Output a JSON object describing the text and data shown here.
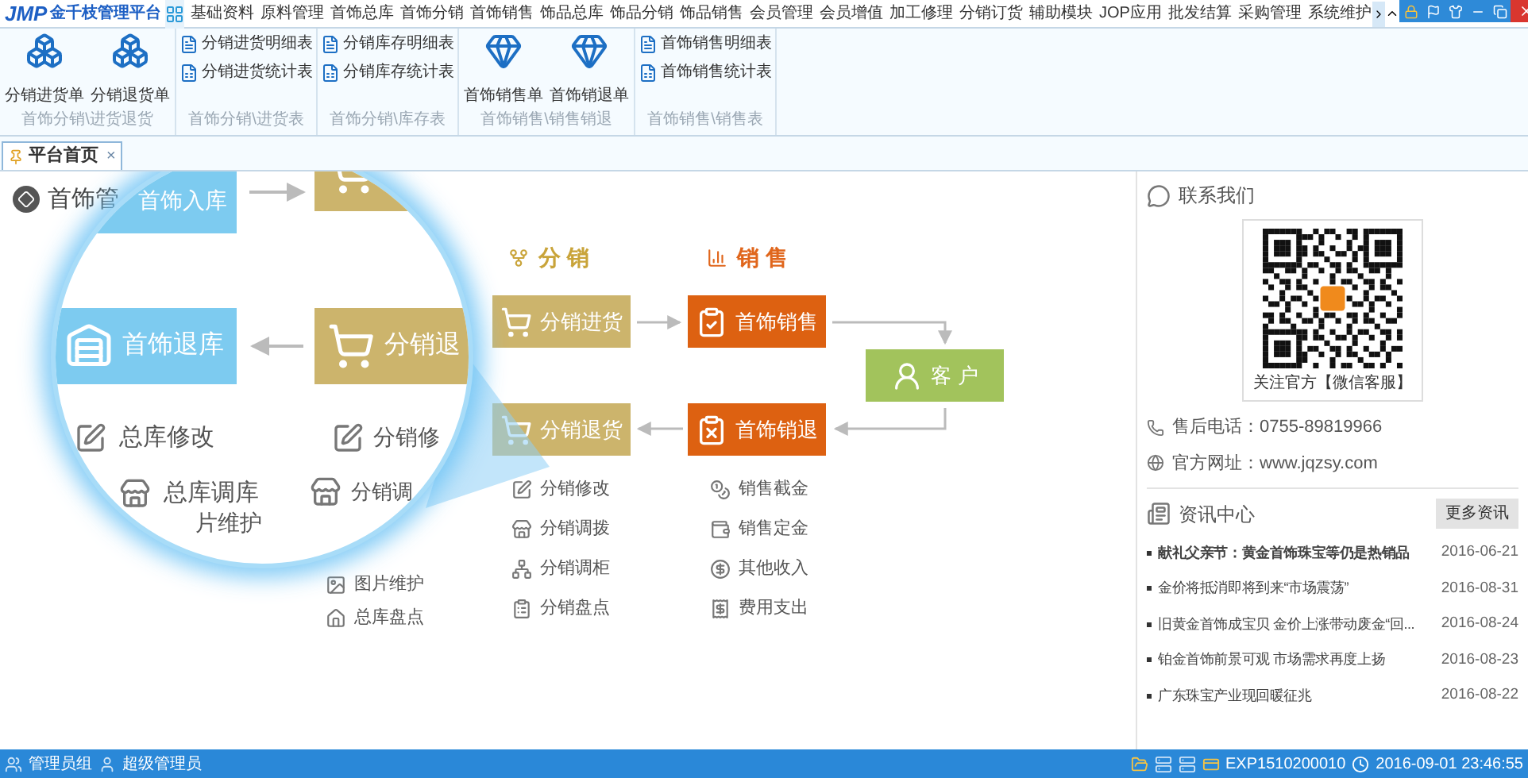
{
  "app": {
    "logo": "JMP",
    "title": "金千枝管理平台"
  },
  "menu": [
    "基础资料",
    "原料管理",
    "首饰总库",
    "首饰分销",
    "首饰销售",
    "饰品总库",
    "饰品分销",
    "饰品销售",
    "会员管理",
    "会员增值",
    "加工修理",
    "分销订货",
    "辅助模块",
    "JOP应用",
    "批发结算",
    "采购管理",
    "系统维护"
  ],
  "ribbon_groups": [
    {
      "kind": "large",
      "caption": "首饰分销\\进货退货",
      "buttons": [
        "分销进货单",
        "分销退货单"
      ]
    },
    {
      "kind": "small",
      "caption": "首饰分销\\进货表",
      "buttons": [
        "分销进货明细表",
        "分销进货统计表"
      ]
    },
    {
      "kind": "small",
      "caption": "首饰分销\\库存表",
      "buttons": [
        "分销库存明细表",
        "分销库存统计表"
      ]
    },
    {
      "kind": "large",
      "caption": "首饰销售\\销售销退",
      "buttons": [
        "首饰销售单",
        "首饰销退单"
      ]
    },
    {
      "kind": "small",
      "caption": "首饰销售\\销售表",
      "buttons": [
        "首饰销售明细表",
        "首饰销售统计表"
      ]
    }
  ],
  "tabs": [
    {
      "label": "平台首页",
      "close": "×",
      "selected": true
    }
  ],
  "page": {
    "title": "首饰管",
    "headers": [
      {
        "label": "分 销",
        "color": "#c9a43a"
      },
      {
        "label": "销 售",
        "color": "#e0661c"
      }
    ],
    "nodes": [
      {
        "label": "分销进货",
        "color": "#ccb46c"
      },
      {
        "label": "首饰销售",
        "color": "#dd6111"
      },
      {
        "label": "客 户",
        "color": "#a2c35c"
      },
      {
        "label": "首饰销退",
        "color": "#dd6111"
      },
      {
        "label": "分销退货",
        "color": "#ccb46c"
      }
    ],
    "left_list": [
      "图片维护",
      "总库盘点"
    ],
    "distribution_list": [
      "分销修改",
      "分销调拨",
      "分销调柜",
      "分销盘点"
    ],
    "sales_list": [
      "销售截金",
      "销售定金",
      "其他收入",
      "费用支出"
    ],
    "magnifier": {
      "nodes": [
        {
          "label": "首饰入库",
          "color": "#7dcbf0"
        },
        {
          "color": "#ccb46c"
        },
        {
          "label": "首饰退库",
          "color": "#7dcbf0"
        },
        {
          "label": "分销退",
          "color": "#ccb46c"
        }
      ],
      "left_items": [
        "总库修改",
        "总库调库",
        "片维护"
      ],
      "right_items": [
        "分销修",
        "分销调"
      ]
    }
  },
  "contact": {
    "title": "联系我们",
    "qr_caption": "关注官方【微信客服】",
    "phone": "售后电话：0755-89819966",
    "website": "官方网址：www.jqzsy.com"
  },
  "news": {
    "title": "资讯中心",
    "more": "更多资讯",
    "items": [
      {
        "title": "献礼父亲节：黄金首饰珠宝等仍是热销品",
        "date": "2016-06-21",
        "bold": true
      },
      {
        "title": "金价将抵消即将到来“市场震荡”",
        "date": "2016-08-31",
        "bold": false
      },
      {
        "title": "旧黄金首饰成宝贝 金价上涨带动废金“回...",
        "date": "2016-08-24",
        "bold": false
      },
      {
        "title": "铂金首饰前景可观 市场需求再度上扬",
        "date": "2016-08-23",
        "bold": false
      },
      {
        "title": "广东珠宝产业现回暖征兆",
        "date": "2016-08-22",
        "bold": false
      }
    ]
  },
  "status": {
    "group": "管理员组",
    "user": "超级管理员",
    "code": "EXP1510200010",
    "time": "2016-09-01 23:46:55"
  }
}
